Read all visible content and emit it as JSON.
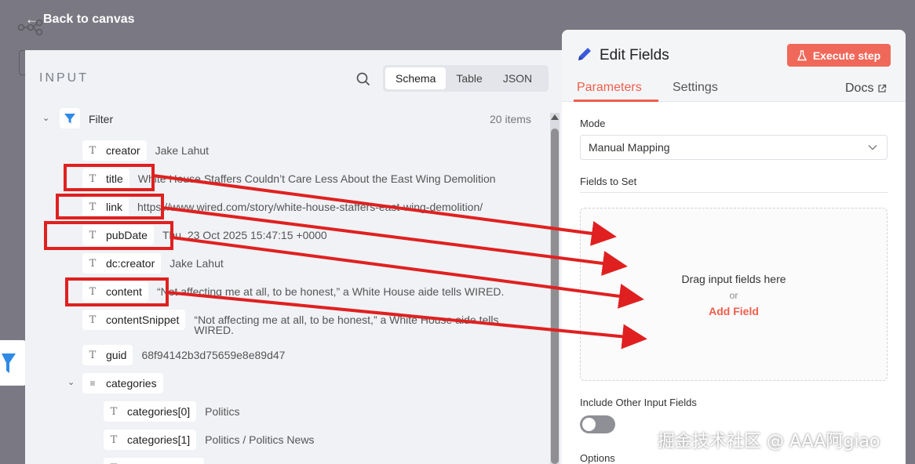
{
  "header": {
    "back_label": "Back to canvas",
    "back_icon": "arrow-left-icon"
  },
  "input_panel": {
    "title": "INPUT",
    "view_tabs": [
      {
        "label": "Schema",
        "active": true
      },
      {
        "label": "Table",
        "active": false
      },
      {
        "label": "JSON",
        "active": false
      }
    ],
    "node_name": "Filter",
    "item_count": "20 items",
    "fields": [
      {
        "type": "string",
        "name": "creator",
        "value": "Jake Lahut"
      },
      {
        "type": "string",
        "name": "title",
        "value": "White House Staffers Couldn’t Care Less About the East Wing Demolition"
      },
      {
        "type": "string",
        "name": "link",
        "value": "https://www.wired.com/story/white-house-staffers-east-wing-demolition/"
      },
      {
        "type": "string",
        "name": "pubDate",
        "value": "Thu, 23 Oct 2025 15:47:15 +0000"
      },
      {
        "type": "string",
        "name": "dc:creator",
        "value": "Jake Lahut"
      },
      {
        "type": "string",
        "name": "content",
        "value": "“Not affecting me at all, to be honest,” a White House aide tells WIRED."
      },
      {
        "type": "string",
        "name": "contentSnippet",
        "value": "“Not affecting me at all, to be honest,” a White House aide tells WIRED."
      },
      {
        "type": "string",
        "name": "guid",
        "value": "68f94142b3d75659e8e89d47"
      },
      {
        "type": "array",
        "name": "categories",
        "value": ""
      },
      {
        "type": "string",
        "name": "categories[0]",
        "value": "Politics"
      },
      {
        "type": "string",
        "name": "categories[1]",
        "value": "Politics / Politics News"
      }
    ]
  },
  "edit_panel": {
    "title": "Edit Fields",
    "execute_label": "Execute step",
    "tabs": [
      {
        "label": "Parameters",
        "active": true
      },
      {
        "label": "Settings",
        "active": false
      }
    ],
    "docs_label": "Docs",
    "mode_label": "Mode",
    "mode_value": "Manual Mapping",
    "fields_to_set_label": "Fields to Set",
    "drop_text": "Drag input fields here",
    "drop_or": "or",
    "add_field_label": "Add Field",
    "include_other_label": "Include Other Input Fields",
    "include_other_enabled": false,
    "options_label": "Options"
  },
  "colors": {
    "accent": "#f05d4b",
    "execute_button": "#f0685a",
    "annotation_red": "#e02020",
    "backdrop": "#7a7983"
  },
  "watermark": "掘金技术社区 @ AAA阿giao"
}
